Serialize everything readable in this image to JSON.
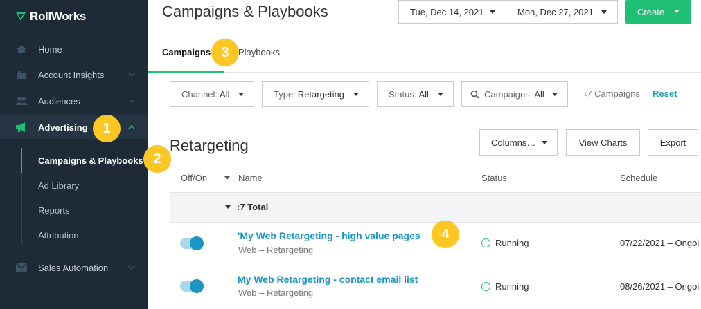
{
  "app": {
    "logo": "RollWorks"
  },
  "sidebar": {
    "items": [
      {
        "label": "Home",
        "icon": "home-icon"
      },
      {
        "label": "Account Insights",
        "icon": "building-icon"
      },
      {
        "label": "Audiences",
        "icon": "people-icon"
      },
      {
        "label": "Advertising",
        "icon": "megaphone-icon"
      },
      {
        "label": "Sales Automation",
        "icon": "envelope-icon"
      }
    ],
    "sub_items": [
      "Campaigns & Playbooks",
      "Ad Library",
      "Reports",
      "Attribution"
    ]
  },
  "header": {
    "title": "Campaigns & Playbooks",
    "start_date": "Tue, Dec 14, 2021",
    "end_date": "Mon, Dec 27, 2021",
    "create_label": "Create"
  },
  "tabs": [
    "Campaigns",
    "Playbooks"
  ],
  "filters": {
    "channel": {
      "key": "Channel:",
      "value": "All"
    },
    "type": {
      "key": "Type:",
      "value": "Retargeting"
    },
    "status": {
      "key": "Status:",
      "value": "All"
    },
    "campaigns": {
      "key": "Campaigns:",
      "value": "All"
    },
    "count_text": "‹7 Campaigns",
    "reset_label": "Reset"
  },
  "section": {
    "title": "Retargeting",
    "columns_label": "Columns…",
    "view_charts_label": "View Charts",
    "export_label": "Export"
  },
  "table": {
    "headers": {
      "off_on": "Off/On",
      "name": "Name",
      "status": "Status",
      "schedule": "Schedule"
    },
    "total_label": ":7  Total",
    "rows": [
      {
        "name": "'My Web Retargeting - high value pages",
        "sub": "Web – Retargeting",
        "status": "Running",
        "schedule": "07/22/2021 – Ongoi"
      },
      {
        "name": "My Web Retargeting -  contact email list",
        "sub": "Web – Retargeting",
        "status": "Running",
        "schedule": "08/26/2021 – Ongoi"
      }
    ]
  },
  "callouts": [
    "1",
    "2",
    "3",
    "4"
  ],
  "colors": {
    "sidebar_bg": "#1e2a36",
    "accent_green": "#1fbf75",
    "link_blue": "#1a95c4",
    "callout_yellow": "#fcc623"
  }
}
